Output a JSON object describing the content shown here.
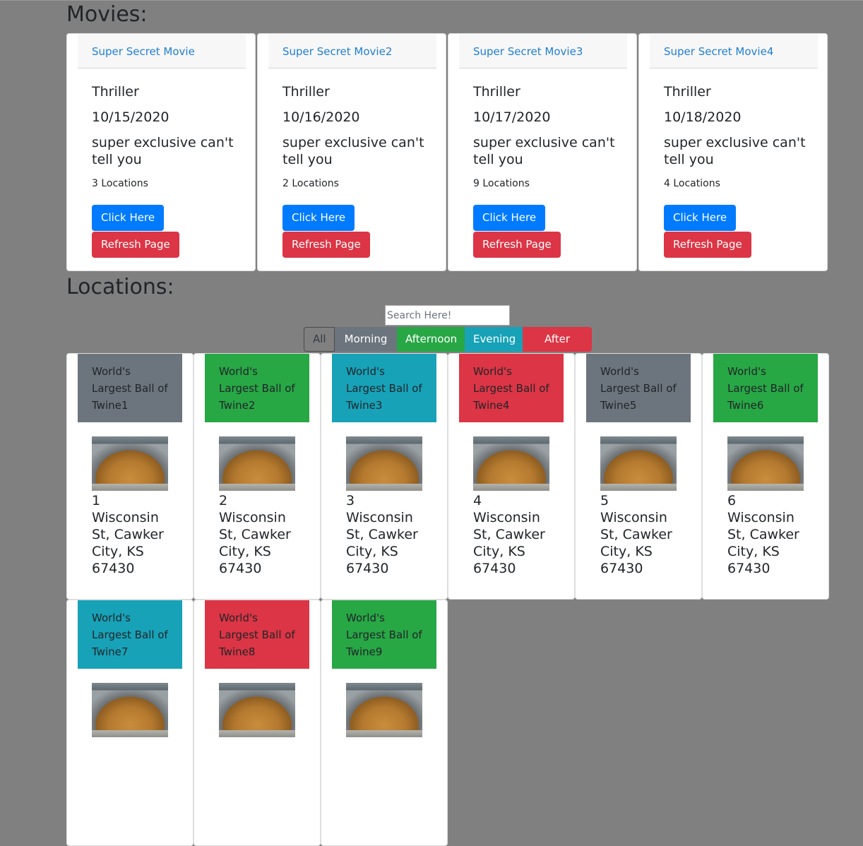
{
  "headings": {
    "movies": "Movies:",
    "locations": "Locations:"
  },
  "movies": [
    {
      "title": "Super Secret Movie",
      "genre": "Thriller",
      "date": "10/15/2020",
      "description": "super exclusive can't tell you",
      "locations": "3 Locations",
      "primary_btn": "Click Here",
      "danger_btn": "Refresh Page"
    },
    {
      "title": "Super Secret Movie2",
      "genre": "Thriller",
      "date": "10/16/2020",
      "description": "super exclusive can't tell you",
      "locations": "2 Locations",
      "primary_btn": "Click Here",
      "danger_btn": "Refresh Page"
    },
    {
      "title": "Super Secret Movie3",
      "genre": "Thriller",
      "date": "10/17/2020",
      "description": "super exclusive can't tell you",
      "locations": "9 Locations",
      "primary_btn": "Click Here",
      "danger_btn": "Refresh Page"
    },
    {
      "title": "Super Secret Movie4",
      "genre": "Thriller",
      "date": "10/18/2020",
      "description": "super exclusive can't tell you",
      "locations": "4 Locations",
      "primary_btn": "Click Here",
      "danger_btn": "Refresh Page"
    }
  ],
  "search": {
    "placeholder": "Search Here!"
  },
  "filters": {
    "all": "All",
    "morning": "Morning",
    "afternoon": "Afternoon",
    "evening": "Evening",
    "after_dark": "After Dark"
  },
  "colors": {
    "morning": "#6c757d",
    "afternoon": "#28a745",
    "evening": "#17a2b8",
    "after_dark": "#dc3545"
  },
  "locations": [
    {
      "name": "World's Largest Ball of Twine1",
      "address": "1 Wisconsin St, Cawker City, KS 67430"
    },
    {
      "name": "World's Largest Ball of Twine2",
      "address": "2 Wisconsin St, Cawker City, KS 67430"
    },
    {
      "name": "World's Largest Ball of Twine3",
      "address": "3 Wisconsin St, Cawker City, KS 67430"
    },
    {
      "name": "World's Largest Ball of Twine4",
      "address": "4 Wisconsin St, Cawker City, KS 67430"
    },
    {
      "name": "World's Largest Ball of Twine5",
      "address": "5 Wisconsin St, Cawker City, KS 67430"
    },
    {
      "name": "World's Largest Ball of Twine6",
      "address": "6 Wisconsin St, Cawker City, KS 67430"
    },
    {
      "name": "World's Largest Ball of Twine7",
      "address": ""
    },
    {
      "name": "World's Largest Ball of Twine8",
      "address": ""
    },
    {
      "name": "World's Largest Ball of Twine9",
      "address": ""
    }
  ]
}
